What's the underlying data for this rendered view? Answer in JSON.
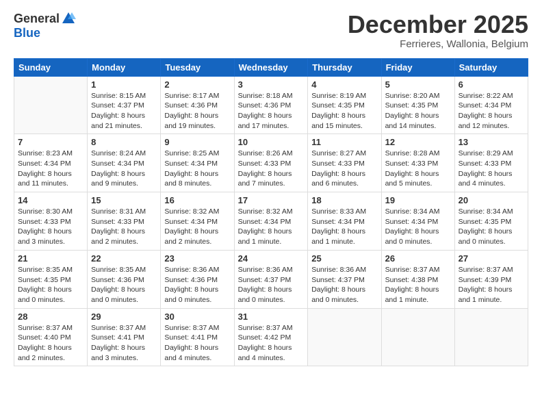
{
  "logo": {
    "general": "General",
    "blue": "Blue"
  },
  "header": {
    "month": "December 2025",
    "location": "Ferrieres, Wallonia, Belgium"
  },
  "weekdays": [
    "Sunday",
    "Monday",
    "Tuesday",
    "Wednesday",
    "Thursday",
    "Friday",
    "Saturday"
  ],
  "weeks": [
    [
      {
        "day": "",
        "info": ""
      },
      {
        "day": "1",
        "info": "Sunrise: 8:15 AM\nSunset: 4:37 PM\nDaylight: 8 hours\nand 21 minutes."
      },
      {
        "day": "2",
        "info": "Sunrise: 8:17 AM\nSunset: 4:36 PM\nDaylight: 8 hours\nand 19 minutes."
      },
      {
        "day": "3",
        "info": "Sunrise: 8:18 AM\nSunset: 4:36 PM\nDaylight: 8 hours\nand 17 minutes."
      },
      {
        "day": "4",
        "info": "Sunrise: 8:19 AM\nSunset: 4:35 PM\nDaylight: 8 hours\nand 15 minutes."
      },
      {
        "day": "5",
        "info": "Sunrise: 8:20 AM\nSunset: 4:35 PM\nDaylight: 8 hours\nand 14 minutes."
      },
      {
        "day": "6",
        "info": "Sunrise: 8:22 AM\nSunset: 4:34 PM\nDaylight: 8 hours\nand 12 minutes."
      }
    ],
    [
      {
        "day": "7",
        "info": "Sunrise: 8:23 AM\nSunset: 4:34 PM\nDaylight: 8 hours\nand 11 minutes."
      },
      {
        "day": "8",
        "info": "Sunrise: 8:24 AM\nSunset: 4:34 PM\nDaylight: 8 hours\nand 9 minutes."
      },
      {
        "day": "9",
        "info": "Sunrise: 8:25 AM\nSunset: 4:34 PM\nDaylight: 8 hours\nand 8 minutes."
      },
      {
        "day": "10",
        "info": "Sunrise: 8:26 AM\nSunset: 4:33 PM\nDaylight: 8 hours\nand 7 minutes."
      },
      {
        "day": "11",
        "info": "Sunrise: 8:27 AM\nSunset: 4:33 PM\nDaylight: 8 hours\nand 6 minutes."
      },
      {
        "day": "12",
        "info": "Sunrise: 8:28 AM\nSunset: 4:33 PM\nDaylight: 8 hours\nand 5 minutes."
      },
      {
        "day": "13",
        "info": "Sunrise: 8:29 AM\nSunset: 4:33 PM\nDaylight: 8 hours\nand 4 minutes."
      }
    ],
    [
      {
        "day": "14",
        "info": "Sunrise: 8:30 AM\nSunset: 4:33 PM\nDaylight: 8 hours\nand 3 minutes."
      },
      {
        "day": "15",
        "info": "Sunrise: 8:31 AM\nSunset: 4:33 PM\nDaylight: 8 hours\nand 2 minutes."
      },
      {
        "day": "16",
        "info": "Sunrise: 8:32 AM\nSunset: 4:34 PM\nDaylight: 8 hours\nand 2 minutes."
      },
      {
        "day": "17",
        "info": "Sunrise: 8:32 AM\nSunset: 4:34 PM\nDaylight: 8 hours\nand 1 minute."
      },
      {
        "day": "18",
        "info": "Sunrise: 8:33 AM\nSunset: 4:34 PM\nDaylight: 8 hours\nand 1 minute."
      },
      {
        "day": "19",
        "info": "Sunrise: 8:34 AM\nSunset: 4:34 PM\nDaylight: 8 hours\nand 0 minutes."
      },
      {
        "day": "20",
        "info": "Sunrise: 8:34 AM\nSunset: 4:35 PM\nDaylight: 8 hours\nand 0 minutes."
      }
    ],
    [
      {
        "day": "21",
        "info": "Sunrise: 8:35 AM\nSunset: 4:35 PM\nDaylight: 8 hours\nand 0 minutes."
      },
      {
        "day": "22",
        "info": "Sunrise: 8:35 AM\nSunset: 4:36 PM\nDaylight: 8 hours\nand 0 minutes."
      },
      {
        "day": "23",
        "info": "Sunrise: 8:36 AM\nSunset: 4:36 PM\nDaylight: 8 hours\nand 0 minutes."
      },
      {
        "day": "24",
        "info": "Sunrise: 8:36 AM\nSunset: 4:37 PM\nDaylight: 8 hours\nand 0 minutes."
      },
      {
        "day": "25",
        "info": "Sunrise: 8:36 AM\nSunset: 4:37 PM\nDaylight: 8 hours\nand 0 minutes."
      },
      {
        "day": "26",
        "info": "Sunrise: 8:37 AM\nSunset: 4:38 PM\nDaylight: 8 hours\nand 1 minute."
      },
      {
        "day": "27",
        "info": "Sunrise: 8:37 AM\nSunset: 4:39 PM\nDaylight: 8 hours\nand 1 minute."
      }
    ],
    [
      {
        "day": "28",
        "info": "Sunrise: 8:37 AM\nSunset: 4:40 PM\nDaylight: 8 hours\nand 2 minutes."
      },
      {
        "day": "29",
        "info": "Sunrise: 8:37 AM\nSunset: 4:41 PM\nDaylight: 8 hours\nand 3 minutes."
      },
      {
        "day": "30",
        "info": "Sunrise: 8:37 AM\nSunset: 4:41 PM\nDaylight: 8 hours\nand 4 minutes."
      },
      {
        "day": "31",
        "info": "Sunrise: 8:37 AM\nSunset: 4:42 PM\nDaylight: 8 hours\nand 4 minutes."
      },
      {
        "day": "",
        "info": ""
      },
      {
        "day": "",
        "info": ""
      },
      {
        "day": "",
        "info": ""
      }
    ]
  ]
}
